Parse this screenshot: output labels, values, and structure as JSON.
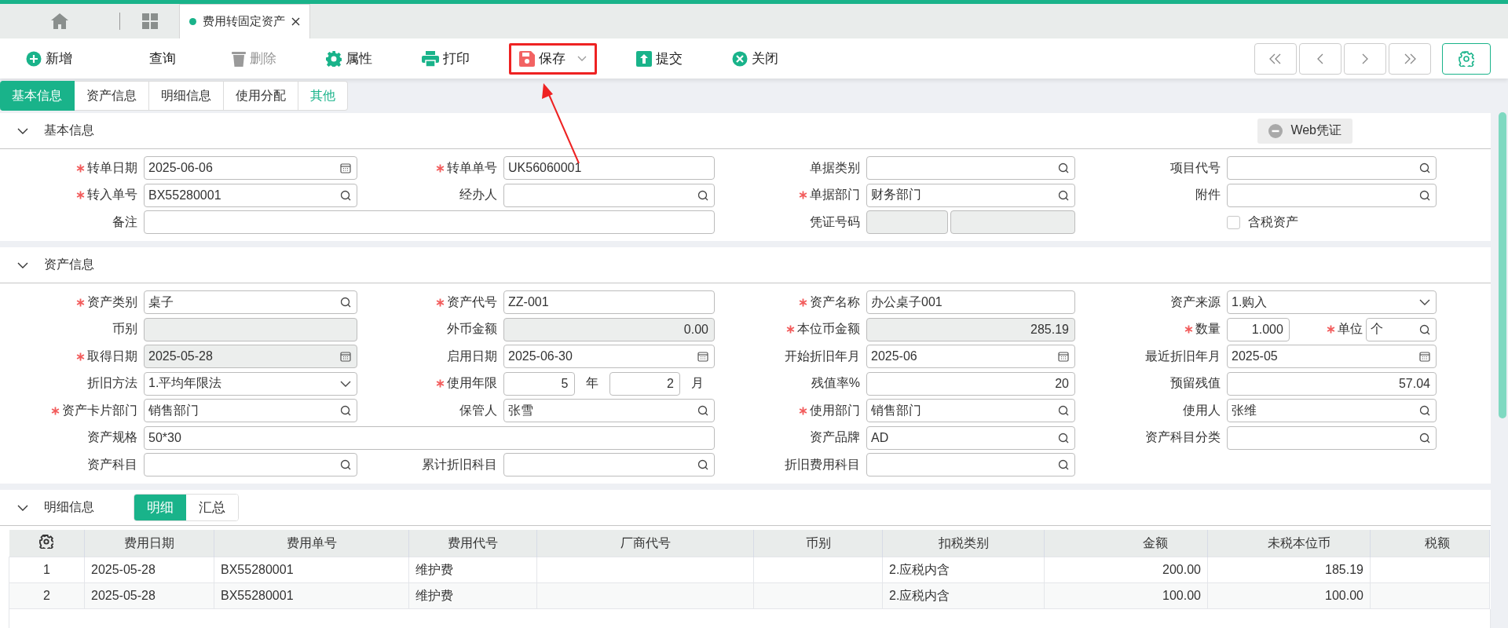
{
  "tab_strip": {
    "tabs": [
      {
        "label": "费用转固定资产",
        "selected": true
      }
    ]
  },
  "toolbar": {
    "buttons": [
      {
        "label": "新增",
        "kind": "add",
        "disabled": false,
        "highlighted": false,
        "dropdown": false
      },
      {
        "label": "查询",
        "kind": "plain",
        "disabled": false,
        "highlighted": false,
        "dropdown": false
      },
      {
        "label": "删除",
        "kind": "delete",
        "disabled": true,
        "highlighted": false,
        "dropdown": false
      },
      {
        "label": "属性",
        "kind": "settings",
        "disabled": false,
        "highlighted": false,
        "dropdown": false
      },
      {
        "label": "打印",
        "kind": "print",
        "disabled": false,
        "highlighted": false,
        "dropdown": false
      },
      {
        "label": "保存",
        "kind": "save",
        "disabled": false,
        "highlighted": true,
        "dropdown": true
      },
      {
        "label": "提交",
        "kind": "submit",
        "disabled": false,
        "highlighted": false,
        "dropdown": false
      },
      {
        "label": "关闭",
        "kind": "close",
        "disabled": false,
        "highlighted": false,
        "dropdown": false
      }
    ]
  },
  "section_tabs": [
    {
      "label": "基本信息",
      "selected": true,
      "hovered": false
    },
    {
      "label": "资产信息",
      "selected": false,
      "hovered": false
    },
    {
      "label": "明细信息",
      "selected": false,
      "hovered": false
    },
    {
      "label": "使用分配",
      "selected": false,
      "hovered": false
    },
    {
      "label": "其他",
      "selected": false,
      "hovered": true
    }
  ],
  "sections": [
    {
      "kind": "form",
      "title": "基本信息",
      "expanded": true,
      "action": {
        "label": "Web凭证"
      },
      "rows": [
        [
          {
            "label": "转单日期",
            "required": true,
            "kind": "date",
            "value": "2025-06-06",
            "disabled": false
          },
          {
            "label": "转单单号",
            "required": true,
            "kind": "text",
            "value": "UK56060001",
            "disabled": false
          },
          {
            "label": "单据类别",
            "required": false,
            "kind": "search",
            "disabled": false
          },
          {
            "label": "项目代号",
            "required": false,
            "kind": "search",
            "disabled": false
          }
        ],
        [
          {
            "label": "转入单号",
            "required": true,
            "kind": "search",
            "value": "BX55280001",
            "disabled": false
          },
          {
            "label": "经办人",
            "required": false,
            "kind": "search",
            "disabled": false
          },
          {
            "label": "单据部门",
            "required": true,
            "kind": "search",
            "value": "财务部门",
            "disabled": false
          },
          {
            "label": "附件",
            "required": false,
            "kind": "search",
            "disabled": false
          }
        ],
        [
          {
            "label": "备注",
            "required": false,
            "kind": "long-text",
            "disabled": false
          },
          "",
          {
            "label": "凭证号码",
            "required": false,
            "kind": "pair",
            "disabled": true
          },
          {
            "kind": "checkbox",
            "text": "含税资产",
            "checked": false
          }
        ]
      ]
    },
    {
      "kind": "form",
      "title": "资产信息",
      "expanded": true,
      "rows": [
        [
          {
            "label": "资产类别",
            "required": true,
            "kind": "search",
            "value": "桌子",
            "disabled": false
          },
          {
            "label": "资产代号",
            "required": true,
            "kind": "text",
            "value": "ZZ-001",
            "disabled": false
          },
          {
            "label": "资产名称",
            "required": true,
            "kind": "text",
            "value": "办公桌子001",
            "disabled": false
          },
          {
            "label": "资产来源",
            "required": false,
            "kind": "select",
            "value": "1.购入",
            "disabled": false
          }
        ],
        [
          {
            "label": "币别",
            "required": false,
            "kind": "text",
            "disabled": true
          },
          {
            "label": "外币金额",
            "required": false,
            "kind": "number",
            "value": "0.00",
            "disabled": true
          },
          {
            "label": "本位币金额",
            "required": true,
            "kind": "number",
            "value": "285.19",
            "disabled": true
          },
          {
            "label": "数量",
            "required": true,
            "kind": "qty",
            "value": "1.000",
            "disabled": false,
            "unit_label": "单位",
            "unit_required": true,
            "unit": "个"
          }
        ],
        [
          {
            "label": "取得日期",
            "required": true,
            "kind": "date",
            "value": "2025-05-28",
            "disabled": true
          },
          {
            "label": "启用日期",
            "required": false,
            "kind": "date",
            "value": "2025-06-30",
            "disabled": false
          },
          {
            "label": "开始折旧年月",
            "required": false,
            "kind": "date",
            "value": "2025-06",
            "disabled": false
          },
          {
            "label": "最近折旧年月",
            "required": false,
            "kind": "date",
            "value": "2025-05",
            "disabled": false
          }
        ],
        [
          {
            "label": "折旧方法",
            "required": false,
            "kind": "select",
            "value": "1.平均年限法",
            "disabled": false
          },
          {
            "label": "使用年限",
            "required": true,
            "kind": "years",
            "value": "5",
            "unit_label": "年",
            "months": "2",
            "months_label": "月",
            "disabled": false
          },
          {
            "label": "残值率%",
            "required": false,
            "kind": "number",
            "value": "20",
            "disabled": false
          },
          {
            "label": "预留残值",
            "required": false,
            "kind": "number",
            "value": "57.04",
            "disabled": false
          }
        ],
        [
          {
            "label": "资产卡片部门",
            "required": true,
            "kind": "search",
            "value": "销售部门",
            "disabled": false
          },
          {
            "label": "保管人",
            "required": false,
            "kind": "search",
            "value": "张雪",
            "disabled": false
          },
          {
            "label": "使用部门",
            "required": true,
            "kind": "search",
            "value": "销售部门",
            "disabled": false
          },
          {
            "label": "使用人",
            "required": false,
            "kind": "search",
            "value": "张维",
            "disabled": false
          }
        ],
        [
          {
            "label": "资产规格",
            "required": false,
            "kind": "long-text",
            "value": "50*30",
            "disabled": false
          },
          "",
          {
            "label": "资产品牌",
            "required": false,
            "kind": "search",
            "value": "AD",
            "disabled": false
          },
          {
            "label": "资产科目分类",
            "required": false,
            "kind": "search",
            "disabled": false
          }
        ],
        [
          {
            "label": "资产科目",
            "required": false,
            "kind": "search",
            "disabled": false
          },
          {
            "label": "累计折旧科目",
            "required": false,
            "kind": "search",
            "disabled": false
          },
          {
            "label": "折旧费用科目",
            "required": false,
            "kind": "search",
            "disabled": false
          }
        ]
      ]
    },
    {
      "kind": "table",
      "title": "明细信息",
      "expanded": true,
      "views": [
        {
          "label": "明细",
          "selected": true
        },
        {
          "label": "汇总",
          "selected": false
        }
      ],
      "table": {
        "columns": [
          {
            "label": "费用日期",
            "kind": "text"
          },
          {
            "label": "费用单号",
            "kind": "text"
          },
          {
            "label": "费用代号",
            "kind": "text"
          },
          {
            "label": "厂商代号",
            "kind": "text"
          },
          {
            "label": "币别",
            "kind": "text"
          },
          {
            "label": "扣税类别",
            "kind": "text"
          },
          {
            "label": "金额",
            "kind": "number"
          },
          {
            "label": "未税本位币",
            "kind": "number"
          },
          {
            "label": "税额",
            "kind": "number"
          }
        ],
        "rows": [
          {
            "number": "1",
            "cells": [
              "2025-05-28",
              "BX55280001",
              "维护费",
              "",
              "",
              "2.应税内含",
              "200.00",
              "185.19",
              ""
            ]
          },
          {
            "number": "2",
            "cells": [
              "2025-05-28",
              "BX55280001",
              "维护费",
              "",
              "",
              "2.应税内含",
              "100.00",
              "100.00",
              ""
            ]
          }
        ]
      }
    }
  ]
}
